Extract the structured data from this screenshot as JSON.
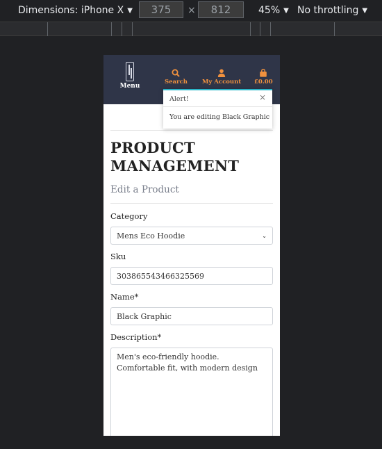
{
  "devtools": {
    "dimensions_label": "Dimensions: iPhone X",
    "width_value": "375",
    "times": "×",
    "height_value": "812",
    "zoom": "45%",
    "throttling": "No throttling"
  },
  "header": {
    "menu_label": "Menu",
    "nav": {
      "search": "Search",
      "account": "My Account",
      "basket": "£0.00"
    }
  },
  "alert": {
    "title": "Alert!",
    "close": "×",
    "message": "You are editing Black Graphic"
  },
  "page": {
    "title": "PRODUCT MANAGEMENT",
    "subtitle": "Edit a Product"
  },
  "form": {
    "category_label": "Category",
    "category_value": "Mens Eco Hoodie",
    "sku_label": "Sku",
    "sku_value": "303865543466325569",
    "name_label": "Name*",
    "name_value": "Black Graphic",
    "description_label": "Description*",
    "description_value": "Men's eco-friendly hoodie. Comfortable fit, with modern design"
  },
  "colors": {
    "header_bg": "#2f3548",
    "accent_orange": "#f0913e",
    "alert_accent": "#2ab6c9"
  }
}
